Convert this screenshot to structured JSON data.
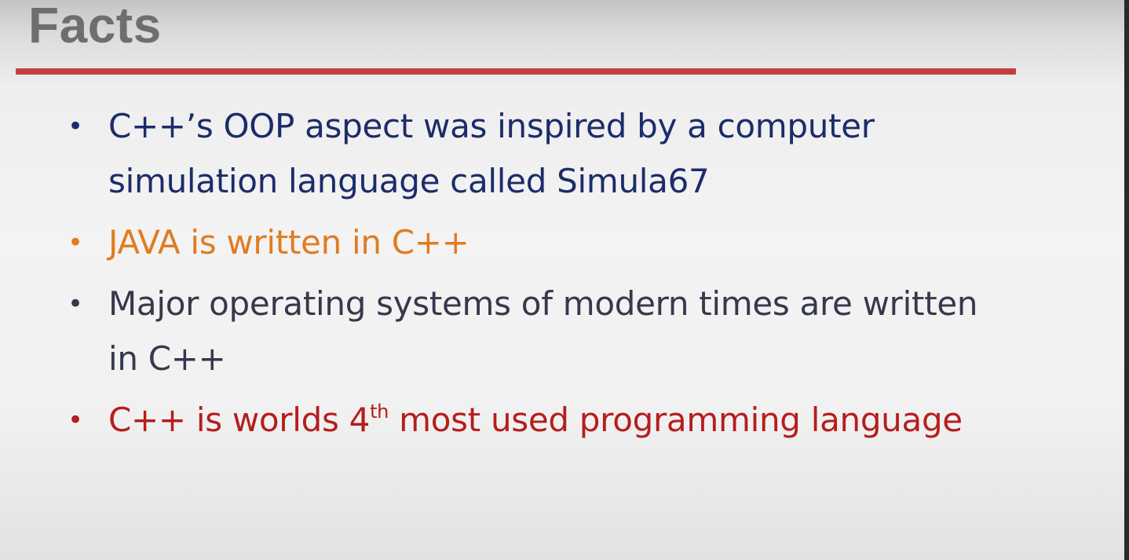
{
  "slide": {
    "title": "Facts",
    "bullets": [
      {
        "text": "C++’s OOP aspect was inspired by a computer simulation language called Simula67",
        "color": "#1c2c6a"
      },
      {
        "text": "JAVA is written in C++",
        "color": "#e07c22"
      },
      {
        "text": "Major operating systems of modern times are written in C++",
        "color": "#36384c"
      },
      {
        "text_before": "C++ is worlds 4",
        "superscript": "th",
        "text_after": " most used programming language",
        "color": "#b61d1d"
      }
    ],
    "bullet_glyph": "•",
    "accent_rule_color": "#c53f3f"
  }
}
